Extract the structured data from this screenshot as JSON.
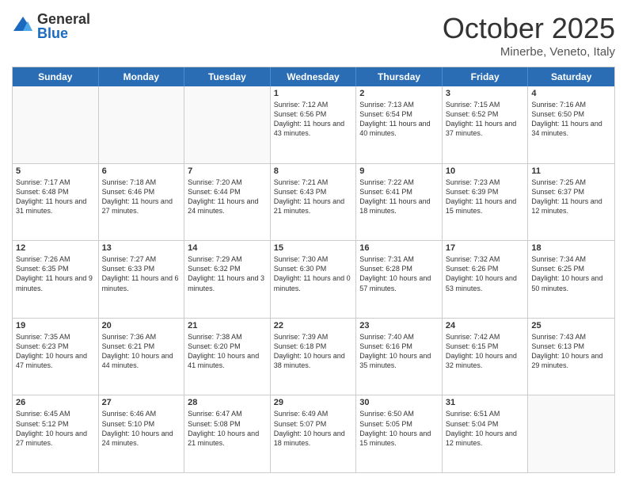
{
  "header": {
    "logo_general": "General",
    "logo_blue": "Blue",
    "month": "October 2025",
    "location": "Minerbe, Veneto, Italy"
  },
  "days_of_week": [
    "Sunday",
    "Monday",
    "Tuesday",
    "Wednesday",
    "Thursday",
    "Friday",
    "Saturday"
  ],
  "weeks": [
    [
      {
        "day": "",
        "info": ""
      },
      {
        "day": "",
        "info": ""
      },
      {
        "day": "",
        "info": ""
      },
      {
        "day": "1",
        "info": "Sunrise: 7:12 AM\nSunset: 6:56 PM\nDaylight: 11 hours and 43 minutes."
      },
      {
        "day": "2",
        "info": "Sunrise: 7:13 AM\nSunset: 6:54 PM\nDaylight: 11 hours and 40 minutes."
      },
      {
        "day": "3",
        "info": "Sunrise: 7:15 AM\nSunset: 6:52 PM\nDaylight: 11 hours and 37 minutes."
      },
      {
        "day": "4",
        "info": "Sunrise: 7:16 AM\nSunset: 6:50 PM\nDaylight: 11 hours and 34 minutes."
      }
    ],
    [
      {
        "day": "5",
        "info": "Sunrise: 7:17 AM\nSunset: 6:48 PM\nDaylight: 11 hours and 31 minutes."
      },
      {
        "day": "6",
        "info": "Sunrise: 7:18 AM\nSunset: 6:46 PM\nDaylight: 11 hours and 27 minutes."
      },
      {
        "day": "7",
        "info": "Sunrise: 7:20 AM\nSunset: 6:44 PM\nDaylight: 11 hours and 24 minutes."
      },
      {
        "day": "8",
        "info": "Sunrise: 7:21 AM\nSunset: 6:43 PM\nDaylight: 11 hours and 21 minutes."
      },
      {
        "day": "9",
        "info": "Sunrise: 7:22 AM\nSunset: 6:41 PM\nDaylight: 11 hours and 18 minutes."
      },
      {
        "day": "10",
        "info": "Sunrise: 7:23 AM\nSunset: 6:39 PM\nDaylight: 11 hours and 15 minutes."
      },
      {
        "day": "11",
        "info": "Sunrise: 7:25 AM\nSunset: 6:37 PM\nDaylight: 11 hours and 12 minutes."
      }
    ],
    [
      {
        "day": "12",
        "info": "Sunrise: 7:26 AM\nSunset: 6:35 PM\nDaylight: 11 hours and 9 minutes."
      },
      {
        "day": "13",
        "info": "Sunrise: 7:27 AM\nSunset: 6:33 PM\nDaylight: 11 hours and 6 minutes."
      },
      {
        "day": "14",
        "info": "Sunrise: 7:29 AM\nSunset: 6:32 PM\nDaylight: 11 hours and 3 minutes."
      },
      {
        "day": "15",
        "info": "Sunrise: 7:30 AM\nSunset: 6:30 PM\nDaylight: 11 hours and 0 minutes."
      },
      {
        "day": "16",
        "info": "Sunrise: 7:31 AM\nSunset: 6:28 PM\nDaylight: 10 hours and 57 minutes."
      },
      {
        "day": "17",
        "info": "Sunrise: 7:32 AM\nSunset: 6:26 PM\nDaylight: 10 hours and 53 minutes."
      },
      {
        "day": "18",
        "info": "Sunrise: 7:34 AM\nSunset: 6:25 PM\nDaylight: 10 hours and 50 minutes."
      }
    ],
    [
      {
        "day": "19",
        "info": "Sunrise: 7:35 AM\nSunset: 6:23 PM\nDaylight: 10 hours and 47 minutes."
      },
      {
        "day": "20",
        "info": "Sunrise: 7:36 AM\nSunset: 6:21 PM\nDaylight: 10 hours and 44 minutes."
      },
      {
        "day": "21",
        "info": "Sunrise: 7:38 AM\nSunset: 6:20 PM\nDaylight: 10 hours and 41 minutes."
      },
      {
        "day": "22",
        "info": "Sunrise: 7:39 AM\nSunset: 6:18 PM\nDaylight: 10 hours and 38 minutes."
      },
      {
        "day": "23",
        "info": "Sunrise: 7:40 AM\nSunset: 6:16 PM\nDaylight: 10 hours and 35 minutes."
      },
      {
        "day": "24",
        "info": "Sunrise: 7:42 AM\nSunset: 6:15 PM\nDaylight: 10 hours and 32 minutes."
      },
      {
        "day": "25",
        "info": "Sunrise: 7:43 AM\nSunset: 6:13 PM\nDaylight: 10 hours and 29 minutes."
      }
    ],
    [
      {
        "day": "26",
        "info": "Sunrise: 6:45 AM\nSunset: 5:12 PM\nDaylight: 10 hours and 27 minutes."
      },
      {
        "day": "27",
        "info": "Sunrise: 6:46 AM\nSunset: 5:10 PM\nDaylight: 10 hours and 24 minutes."
      },
      {
        "day": "28",
        "info": "Sunrise: 6:47 AM\nSunset: 5:08 PM\nDaylight: 10 hours and 21 minutes."
      },
      {
        "day": "29",
        "info": "Sunrise: 6:49 AM\nSunset: 5:07 PM\nDaylight: 10 hours and 18 minutes."
      },
      {
        "day": "30",
        "info": "Sunrise: 6:50 AM\nSunset: 5:05 PM\nDaylight: 10 hours and 15 minutes."
      },
      {
        "day": "31",
        "info": "Sunrise: 6:51 AM\nSunset: 5:04 PM\nDaylight: 10 hours and 12 minutes."
      },
      {
        "day": "",
        "info": ""
      }
    ]
  ]
}
